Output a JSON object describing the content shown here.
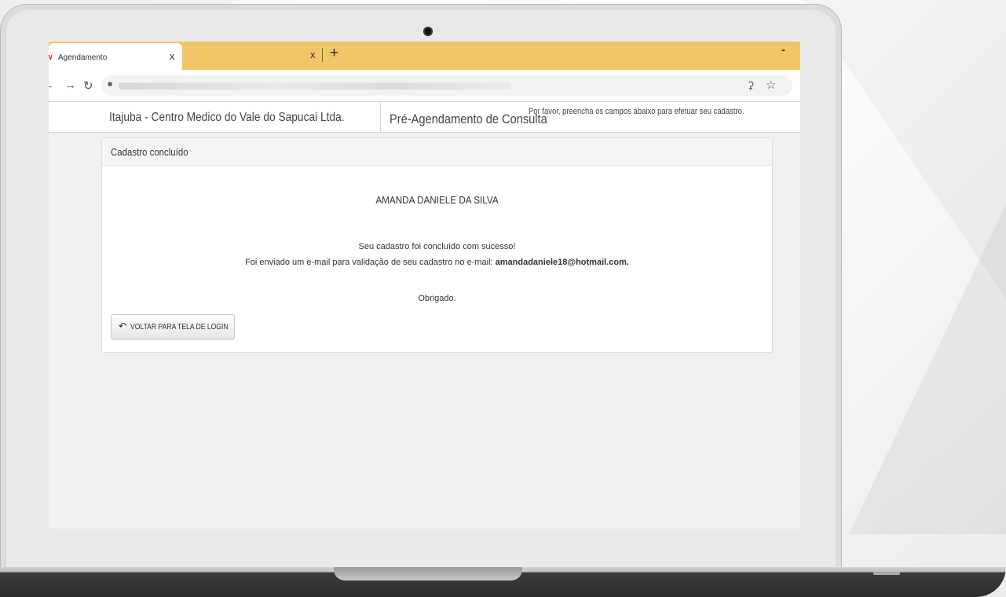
{
  "browser": {
    "active_tab_title": "Agendamento",
    "tab_close_glyph": "x",
    "second_tab_close_glyph": "x",
    "new_tab_glyph": "+",
    "minimize_glyph": "-",
    "tab_color": "#f0c667",
    "icons": [
      "back-arrow-icon",
      "forward-arrow-icon",
      "reload-icon",
      "lock-icon",
      "key-icon",
      "star-icon"
    ]
  },
  "header": {
    "brand": "Itajuba - Centro Medico do Vale do Sapucai Ltda.",
    "title": "Pré-Agendamento de Consulta",
    "subtitle": "Por favor, preencha os campos abaixo para efetuar seu cadastro."
  },
  "card": {
    "heading": "Cadastro concluído",
    "patient_name": "AMANDA DANIELE DA SILVA",
    "success_message": "Seu cadastro foi concluído com sucesso!",
    "email_message": "Foi enviado um e-mail para validação de seu cadastro no e-mail:",
    "email": "amandadaniele18@hotmail.com.",
    "thanks": "Obrigado.",
    "back_button_label": "VOLTAR PARA TELA DE LOGIN"
  }
}
